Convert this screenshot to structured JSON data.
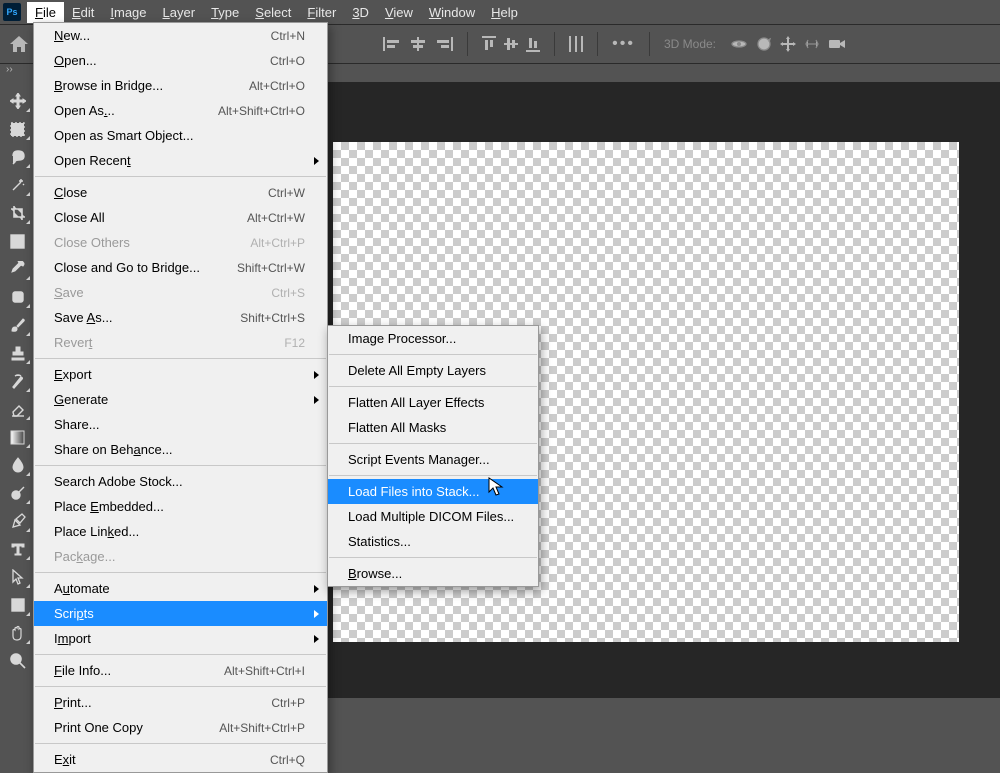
{
  "menubar": [
    "File",
    "Edit",
    "Image",
    "Layer",
    "Type",
    "Select",
    "Filter",
    "3D",
    "View",
    "Window",
    "Help"
  ],
  "opt_mode_label": "3D Mode:",
  "file_menu": [
    {
      "k": "i",
      "t": "New...",
      "u": 0,
      "s": "Ctrl+N"
    },
    {
      "k": "i",
      "t": "Open...",
      "u": 0,
      "s": "Ctrl+O"
    },
    {
      "k": "i",
      "t": "Browse in Bridge...",
      "u": 0,
      "s": "Alt+Ctrl+O"
    },
    {
      "k": "i",
      "t": "Open As...",
      "u": 7,
      "s": "Alt+Shift+Ctrl+O"
    },
    {
      "k": "i",
      "t": "Open as Smart Object..."
    },
    {
      "k": "i",
      "t": "Open Recent",
      "u": 10,
      "sub": true
    },
    {
      "k": "s"
    },
    {
      "k": "i",
      "t": "Close",
      "u": 0,
      "s": "Ctrl+W"
    },
    {
      "k": "i",
      "t": "Close All",
      "s": "Alt+Ctrl+W"
    },
    {
      "k": "i",
      "t": "Close Others",
      "s": "Alt+Ctrl+P",
      "d": true
    },
    {
      "k": "i",
      "t": "Close and Go to Bridge...",
      "s": "Shift+Ctrl+W"
    },
    {
      "k": "i",
      "t": "Save",
      "u": 0,
      "s": "Ctrl+S",
      "d": true
    },
    {
      "k": "i",
      "t": "Save As...",
      "u": 5,
      "s": "Shift+Ctrl+S"
    },
    {
      "k": "i",
      "t": "Revert",
      "u": 5,
      "s": "F12",
      "d": true
    },
    {
      "k": "s"
    },
    {
      "k": "i",
      "t": "Export",
      "u": 0,
      "sub": true
    },
    {
      "k": "i",
      "t": "Generate",
      "u": 0,
      "sub": true
    },
    {
      "k": "i",
      "t": "Share..."
    },
    {
      "k": "i",
      "t": "Share on Behance...",
      "u": 12
    },
    {
      "k": "s"
    },
    {
      "k": "i",
      "t": "Search Adobe Stock..."
    },
    {
      "k": "i",
      "t": "Place Embedded...",
      "u": 6
    },
    {
      "k": "i",
      "t": "Place Linked...",
      "u": 9
    },
    {
      "k": "i",
      "t": "Package...",
      "u": 3,
      "d": true
    },
    {
      "k": "s"
    },
    {
      "k": "i",
      "t": "Automate",
      "u": 1,
      "sub": true
    },
    {
      "k": "i",
      "t": "Scripts",
      "u": 4,
      "sub": true,
      "hl": true
    },
    {
      "k": "i",
      "t": "Import",
      "u": 1,
      "sub": true
    },
    {
      "k": "s"
    },
    {
      "k": "i",
      "t": "File Info...",
      "u": 0,
      "s": "Alt+Shift+Ctrl+I"
    },
    {
      "k": "s"
    },
    {
      "k": "i",
      "t": "Print...",
      "u": 0,
      "s": "Ctrl+P"
    },
    {
      "k": "i",
      "t": "Print One Copy",
      "s": "Alt+Shift+Ctrl+P"
    },
    {
      "k": "s"
    },
    {
      "k": "i",
      "t": "Exit",
      "u": 1,
      "s": "Ctrl+Q"
    }
  ],
  "scripts_menu": [
    {
      "k": "i",
      "t": "Image Processor..."
    },
    {
      "k": "s"
    },
    {
      "k": "i",
      "t": "Delete All Empty Layers"
    },
    {
      "k": "s"
    },
    {
      "k": "i",
      "t": "Flatten All Layer Effects"
    },
    {
      "k": "i",
      "t": "Flatten All Masks"
    },
    {
      "k": "s"
    },
    {
      "k": "i",
      "t": "Script Events Manager..."
    },
    {
      "k": "s"
    },
    {
      "k": "i",
      "t": "Load Files into Stack...",
      "hl": true
    },
    {
      "k": "i",
      "t": "Load Multiple DICOM Files..."
    },
    {
      "k": "i",
      "t": "Statistics..."
    },
    {
      "k": "s"
    },
    {
      "k": "i",
      "t": "Browse...",
      "u": 0
    }
  ]
}
